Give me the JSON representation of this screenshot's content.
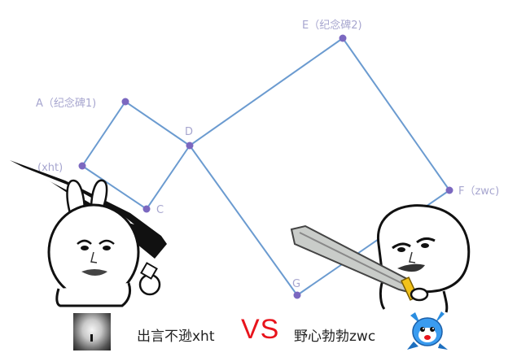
{
  "graph": {
    "nodes": [
      {
        "id": "A",
        "label": "A（纪念碑1)"
      },
      {
        "id": "B",
        "label": "(xht)"
      },
      {
        "id": "C",
        "label": "C"
      },
      {
        "id": "D",
        "label": "D"
      },
      {
        "id": "E",
        "label": "E（纪念碑2)"
      },
      {
        "id": "F",
        "label": "F（zwc)"
      },
      {
        "id": "G",
        "label": "G"
      }
    ],
    "edges": [
      [
        "A",
        "B"
      ],
      [
        "A",
        "D"
      ],
      [
        "B",
        "C"
      ],
      [
        "C",
        "D"
      ],
      [
        "D",
        "E"
      ],
      [
        "E",
        "F"
      ],
      [
        "D",
        "G"
      ],
      [
        "G",
        "F"
      ]
    ],
    "colors": {
      "edge": "#6b9bd0",
      "node": "#7b68c0",
      "label": "#a7a6cf"
    }
  },
  "footer": {
    "left_name": "出言不逊xht",
    "vs": "VS",
    "right_name": "野心勃勃zwc"
  },
  "icons": {
    "left_character": "bunny-meme-with-sword-icon",
    "right_character": "panda-head-meme-with-sword-icon",
    "left_avatar": "silhouette-light-avatar",
    "right_avatar": "blue-cartoon-character-avatar"
  },
  "colors": {
    "vs": "#e8141c",
    "background": "#ffffff"
  }
}
